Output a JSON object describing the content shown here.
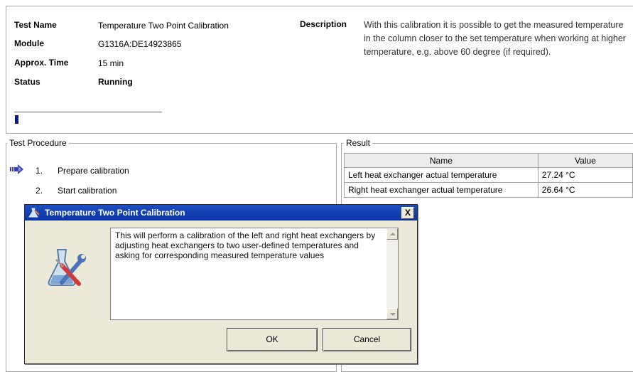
{
  "info": {
    "test_name_label": "Test Name",
    "test_name_value": "Temperature Two Point Calibration",
    "module_label": "Module",
    "module_value": "G1316A:DE14923865",
    "approx_time_label": "Approx. Time",
    "approx_time_value": "15 min",
    "status_label": "Status",
    "status_value": "Running",
    "description_label": "Description",
    "description_text": "With this calibration it is possible to get the measured temperature in the column closer to the set temperature when working at higher temperature, e.g. above 60 degree (if required).",
    "progress_fraction": 0.02
  },
  "procedure": {
    "title": "Test Procedure",
    "current_step_icon": "arrow-right-icon",
    "steps": [
      {
        "num": "1.",
        "label": "Prepare calibration"
      },
      {
        "num": "2.",
        "label": "Start calibration"
      }
    ]
  },
  "result": {
    "title": "Result",
    "columns": [
      "Name",
      "Value"
    ],
    "rows": [
      {
        "name": "Left heat exchanger actual temperature",
        "value": "27.24 °C"
      },
      {
        "name": "Right heat exchanger actual temperature",
        "value": "26.64 °C"
      }
    ]
  },
  "dialog": {
    "title": "Temperature Two Point Calibration",
    "close_label": "X",
    "icon": "calibration-tools-icon",
    "message": "This will perform a calibration of the left and right heat exchangers by adjusting heat exchangers to two user-defined temperatures and asking for corresponding measured temperature values",
    "ok_label": "OK",
    "cancel_label": "Cancel"
  },
  "colors": {
    "titlebar": "#0b33a7",
    "dialog_bg": "#ece9d8",
    "progress": "#0a1a8c"
  }
}
